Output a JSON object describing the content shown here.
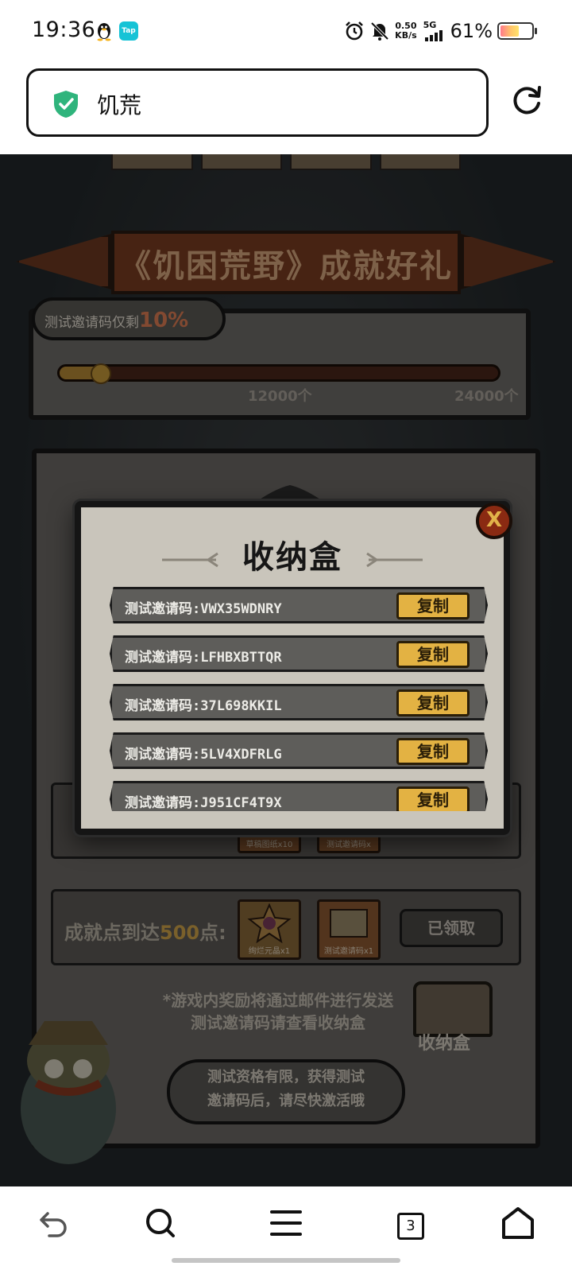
{
  "status_bar": {
    "time": "19:36",
    "tap_badge": "Tap",
    "net_speed_value": "0.50",
    "net_speed_unit": "KB/s",
    "network": "5G",
    "battery_percent": "61%",
    "battery_level": 0.61
  },
  "browser": {
    "url_title": "饥荒",
    "tab_count": "3"
  },
  "page": {
    "banner_title": "《饥困荒野》成就好礼",
    "progress": {
      "remaining_label": "测试邀请码仅剩",
      "remaining_pct": "10%",
      "fraction": 0.1,
      "milestone_1": "12000个",
      "milestone_2": "24000个"
    },
    "reward_rows": [
      {
        "label_pre": "成就点到达",
        "points": "500",
        "label_post": "点:",
        "item1": "绚烂元晶x1",
        "item2": "测试邀请码x1",
        "button": "已领取"
      }
    ],
    "partial_items": {
      "item1": "草稿图纸x10",
      "item2": "测试邀请码x"
    },
    "note_line1": "*游戏内奖励将通过邮件进行发送",
    "note_line2": "测试邀请码请查看收纳盒",
    "chest_label": "收纳盒",
    "bubble_line1": "测试资格有限，获得测试",
    "bubble_line2": "邀请码后，请尽快激活哦"
  },
  "modal": {
    "title": "收纳盒",
    "close_label": "X",
    "copy_label": "复制",
    "codes": [
      "测试邀请码:VWX35WDNRY",
      "测试邀请码:LFHBXBTTQR",
      "测试邀请码:37L698KKIL",
      "测试邀请码:5LV4XDFRLG",
      "测试邀请码:J951CF4T9X"
    ]
  },
  "colors": {
    "copy_button": "#e3b243",
    "close_button": "#8a2a12",
    "shield": "#2fb47c",
    "tap_badge": "#16c3d6"
  },
  "icons": [
    "qq-penguin-icon",
    "tap-icon",
    "alarm-icon",
    "mute-icon",
    "shield-icon",
    "reload-icon",
    "back-icon",
    "search-icon",
    "menu-icon",
    "home-icon"
  ]
}
